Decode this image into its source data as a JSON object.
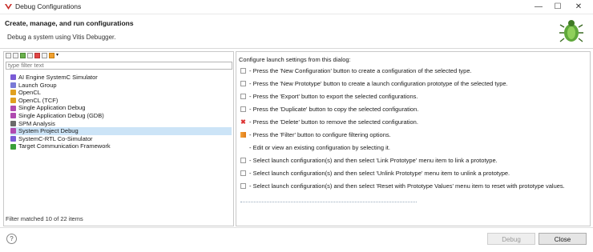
{
  "window": {
    "title": "Debug Configurations",
    "minimize_glyph": "—",
    "maximize_glyph": "☐",
    "close_glyph": "✕"
  },
  "header": {
    "title": "Create, manage, and run configurations",
    "subtitle": "Debug a system using Vitis Debugger."
  },
  "filter": {
    "placeholder": "type filter text"
  },
  "tree": {
    "items": [
      {
        "label": "AI Engine SystemC Simulator",
        "icon": "ai-engine-icon",
        "color": "#7a5bd6"
      },
      {
        "label": "Launch Group",
        "icon": "launch-group-icon",
        "color": "#7a7ad6"
      },
      {
        "label": "OpenCL",
        "icon": "opencl-icon",
        "color": "#e0a020"
      },
      {
        "label": "OpenCL (TCF)",
        "icon": "opencl-tcf-icon",
        "color": "#e0a020"
      },
      {
        "label": "Single Application Debug",
        "icon": "single-app-icon",
        "color": "#b04ab0"
      },
      {
        "label": "Single Application Debug (GDB)",
        "icon": "single-app-gdb-icon",
        "color": "#b04ab0"
      },
      {
        "label": "SPM Analysis",
        "icon": "spm-icon",
        "color": "#6a6a6a"
      },
      {
        "label": "System Project Debug",
        "icon": "system-project-icon",
        "color": "#b04ab0"
      },
      {
        "label": "SystemC-RTL Co-Simulator",
        "icon": "systemc-rtl-icon",
        "color": "#7a5bd6"
      },
      {
        "label": "Target Communication Framework",
        "icon": "tcf-icon",
        "color": "#3aa03a"
      }
    ],
    "selected_index": 7
  },
  "status": "Filter matched 10 of 22 items",
  "right": {
    "heading": "Configure launch settings from this dialog:",
    "instructions": [
      {
        "text": "- Press the 'New Configuration' button to create a configuration of the selected type.",
        "icon": "new-configuration-icon",
        "style": "plain"
      },
      {
        "text": "- Press the 'New Prototype' button to create a launch configuration prototype of the selected type.",
        "icon": "new-prototype-icon",
        "style": "plain"
      },
      {
        "text": "- Press the 'Export' button to export the selected configurations.",
        "icon": "export-icon",
        "style": "plain"
      },
      {
        "text": "- Press the 'Duplicate' button to copy the selected configuration.",
        "icon": "duplicate-icon",
        "style": "plain"
      },
      {
        "text": "- Press the 'Delete' button to remove the selected configuration.",
        "icon": "delete-icon",
        "style": "red"
      },
      {
        "text": "- Press the 'Filter' button to configure filtering options.",
        "icon": "filter-icon",
        "style": "orange"
      },
      {
        "text": "- Edit or view an existing configuration by selecting it.",
        "icon": "edit-icon",
        "style": "blank"
      },
      {
        "text": "- Select launch configuration(s) and then select 'Link Prototype' menu item to link a prototype.",
        "icon": "link-prototype-icon",
        "style": "plain"
      },
      {
        "text": "- Select launch configuration(s) and then select 'Unlink Prototype' menu item to unlink a prototype.",
        "icon": "unlink-prototype-icon",
        "style": "plain"
      },
      {
        "text": "- Select launch configuration(s) and then select 'Reset with Prototype Values' menu item to reset with prototype values.",
        "icon": "reset-prototype-icon",
        "style": "plain"
      }
    ]
  },
  "footer": {
    "help_glyph": "?",
    "debug_label": "Debug",
    "close_label": "Close"
  }
}
